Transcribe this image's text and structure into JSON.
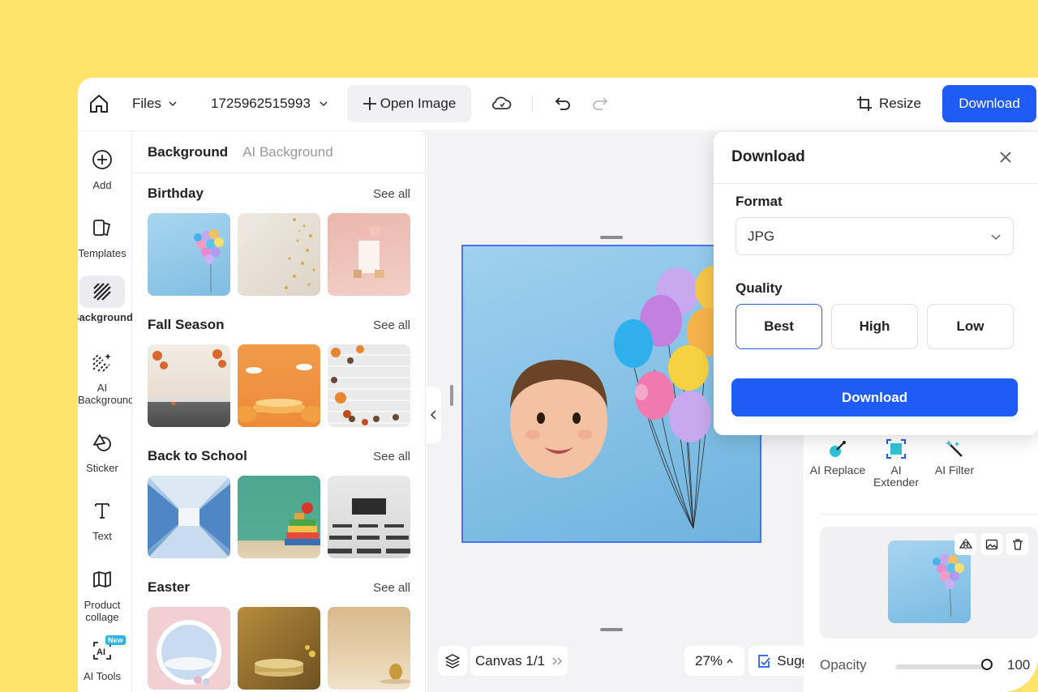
{
  "topbar": {
    "files_label": "Files",
    "project_name": "1725962515993",
    "open_image_label": "Open Image",
    "resize_label": "Resize",
    "download_label": "Download"
  },
  "rail": {
    "items": [
      {
        "label": "Add",
        "icon": "plus-circle-icon"
      },
      {
        "label": "Templates",
        "icon": "templates-icon"
      },
      {
        "label": "Background",
        "icon": "background-icon",
        "active": true
      },
      {
        "label": "AI Background",
        "icon": "ai-background-icon"
      },
      {
        "label": "Sticker",
        "icon": "sticker-icon"
      },
      {
        "label": "Text",
        "icon": "text-icon"
      },
      {
        "label": "Product collage",
        "icon": "collage-icon"
      },
      {
        "label": "AI Tools",
        "icon": "ai-tools-icon",
        "badge": "New"
      }
    ]
  },
  "panel": {
    "tabs": [
      "Background",
      "AI Background"
    ],
    "see_all": "See all",
    "sections": [
      {
        "title": "Birthday"
      },
      {
        "title": "Fall Season"
      },
      {
        "title": "Back to School"
      },
      {
        "title": "Easter"
      }
    ]
  },
  "bottom": {
    "canvas_label": "Canvas 1/1",
    "zoom": "27%",
    "suggest_label": "Suggest",
    "help_label": "?"
  },
  "right": {
    "tools": [
      {
        "label": "AI Replace",
        "icon": "ai-replace-icon"
      },
      {
        "label": "AI Extender",
        "icon": "ai-extender-icon"
      },
      {
        "label": "AI Filter",
        "icon": "ai-filter-icon"
      }
    ],
    "opacity_label": "Opacity",
    "opacity_value": "100",
    "opacity_level": 1.0
  },
  "popup": {
    "title": "Download",
    "format_label": "Format",
    "format_value": "JPG",
    "quality_label": "Quality",
    "quality_options": [
      "Best",
      "High",
      "Low"
    ],
    "quality_selected": "Best",
    "download_label": "Download"
  },
  "colors": {
    "accent": "#1f5cf5",
    "frame": "#ffe36b",
    "selection": "#4a72ea"
  }
}
